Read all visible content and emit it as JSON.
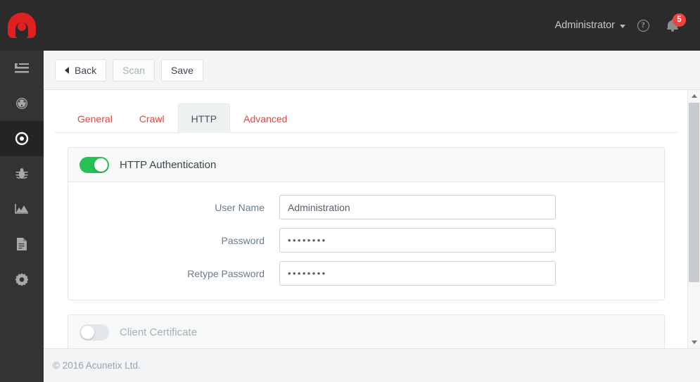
{
  "app": {
    "logo_name": "acunetix-logo",
    "accent_red": "#e8453c",
    "toggle_green": "#25c152",
    "topbar_bg": "#2b2b2b",
    "sidebar_bg": "#333333"
  },
  "topbar": {
    "user_label": "Administrator",
    "help_glyph": "?",
    "notification_count": "5"
  },
  "sidebar": {
    "items": [
      {
        "name": "sidebar-item-menu-toggle",
        "icon": "list-indent-icon",
        "active": false
      },
      {
        "name": "sidebar-item-dashboard",
        "icon": "gauge-icon",
        "active": false
      },
      {
        "name": "sidebar-item-targets",
        "icon": "target-icon",
        "active": true
      },
      {
        "name": "sidebar-item-vulnerabilities",
        "icon": "bug-icon",
        "active": false
      },
      {
        "name": "sidebar-item-scans",
        "icon": "area-chart-icon",
        "active": false
      },
      {
        "name": "sidebar-item-reports",
        "icon": "document-icon",
        "active": false
      },
      {
        "name": "sidebar-item-settings",
        "icon": "gear-icon",
        "active": false
      }
    ]
  },
  "toolbar": {
    "back_label": "Back",
    "scan_label": "Scan",
    "save_label": "Save",
    "scan_disabled": true
  },
  "tabs": [
    {
      "label": "General",
      "active": false
    },
    {
      "label": "Crawl",
      "active": false
    },
    {
      "label": "HTTP",
      "active": true
    },
    {
      "label": "Advanced",
      "active": false
    }
  ],
  "http_auth": {
    "title": "HTTP Authentication",
    "enabled": true,
    "fields": [
      {
        "label": "User Name",
        "value": "Administration",
        "type": "text"
      },
      {
        "label": "Password",
        "value": "••••••••",
        "type": "password"
      },
      {
        "label": "Retype Password",
        "value": "••••••••",
        "type": "password"
      }
    ]
  },
  "client_certificate": {
    "title": "Client Certificate",
    "enabled": false
  },
  "scrollbar": {
    "up_arrow": "chevron-up-icon",
    "down_arrow": "chevron-down-icon"
  },
  "footer": {
    "copyright": "© 2016 Acunetix Ltd."
  }
}
